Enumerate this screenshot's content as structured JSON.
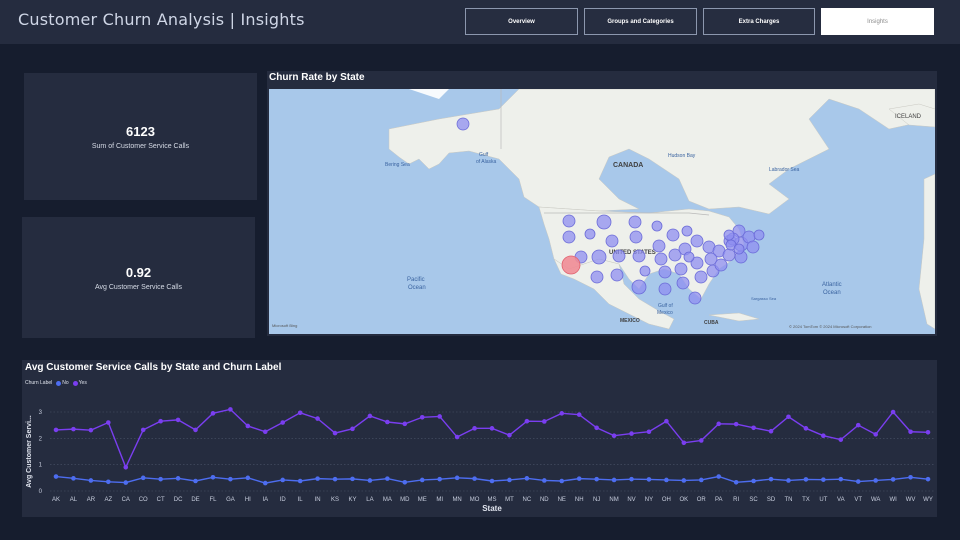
{
  "header": {
    "title": "Customer Churn Analysis | Insights",
    "tabs": [
      {
        "label": "Overview",
        "active": false
      },
      {
        "label": "Groups and Categories",
        "active": false
      },
      {
        "label": "Extra Charges",
        "active": false
      },
      {
        "label": "Insights",
        "active": true
      }
    ]
  },
  "kpis": [
    {
      "value": "6123",
      "label": "Sum of Customer Service Calls"
    },
    {
      "value": "0.92",
      "label": "Avg Customer Service Calls"
    }
  ],
  "map": {
    "title": "Churn Rate by State",
    "labels": {
      "iceland": "ICELAND",
      "bering_sea": "Bering Sea",
      "gulf_of_alaska_1": "Gulf",
      "gulf_of_alaska_2": "of Alaska",
      "canada": "CANADA",
      "hudson_bay": "Hudson Bay",
      "labrador_sea": "Labrador Sea",
      "united_states": "UNITED STATES",
      "pacific_1": "Pacific",
      "pacific_2": "Ocean",
      "atlantic_1": "Atlantic",
      "atlantic_2": "Ocean",
      "sargasso": "Sargasso Sea",
      "gulf_mexico_1": "Gulf of",
      "gulf_mexico_2": "Mexico",
      "mexico": "MEXICO",
      "cuba": "CUBA",
      "microsoft_bing": "Microsoft Bing",
      "copyright": "© 2024 TomTom © 2024 Microsoft Corporation"
    },
    "colors": {
      "bubble": "#8f8ff0",
      "highlight": "#f08c96"
    }
  },
  "chart_data": {
    "type": "line",
    "title": "Avg Customer Service Calls by State and Churn Label",
    "legend_title": "Churn Label",
    "xlabel": "State",
    "ylabel": "Avg Customer Servi...",
    "ylim": [
      0,
      3
    ],
    "yticks": [
      0,
      1,
      2,
      3
    ],
    "grid": true,
    "categories": [
      "AK",
      "AL",
      "AR",
      "AZ",
      "CA",
      "CO",
      "CT",
      "DC",
      "DE",
      "FL",
      "GA",
      "HI",
      "IA",
      "ID",
      "IL",
      "IN",
      "KS",
      "KY",
      "LA",
      "MA",
      "MD",
      "ME",
      "MI",
      "MN",
      "MO",
      "MS",
      "MT",
      "NC",
      "ND",
      "NE",
      "NH",
      "NJ",
      "NM",
      "NV",
      "NY",
      "OH",
      "OK",
      "OR",
      "PA",
      "RI",
      "SC",
      "SD",
      "TN",
      "TX",
      "UT",
      "VA",
      "VT",
      "WA",
      "WI",
      "WV",
      "WY"
    ],
    "series": [
      {
        "name": "No",
        "color": "#4d6df0",
        "values": [
          0.55,
          0.48,
          0.4,
          0.35,
          0.32,
          0.5,
          0.45,
          0.48,
          0.38,
          0.52,
          0.45,
          0.5,
          0.3,
          0.42,
          0.38,
          0.47,
          0.45,
          0.46,
          0.4,
          0.47,
          0.33,
          0.42,
          0.45,
          0.5,
          0.47,
          0.38,
          0.42,
          0.48,
          0.4,
          0.38,
          0.47,
          0.45,
          0.42,
          0.45,
          0.44,
          0.42,
          0.4,
          0.42,
          0.55,
          0.33,
          0.38,
          0.45,
          0.4,
          0.44,
          0.43,
          0.45,
          0.36,
          0.4,
          0.44,
          0.52,
          0.45
        ]
      },
      {
        "name": "Yes",
        "color": "#7a3ef0",
        "values": [
          2.32,
          2.35,
          2.31,
          2.6,
          0.9,
          2.32,
          2.65,
          2.7,
          2.32,
          2.95,
          3.1,
          2.47,
          2.25,
          2.6,
          2.97,
          2.75,
          2.2,
          2.36,
          2.85,
          2.62,
          2.55,
          2.8,
          2.83,
          2.05,
          2.38,
          2.38,
          2.12,
          2.65,
          2.64,
          2.95,
          2.9,
          2.4,
          2.1,
          2.18,
          2.25,
          2.65,
          1.83,
          1.92,
          2.55,
          2.54,
          2.4,
          2.27,
          2.82,
          2.38,
          2.1,
          1.95,
          2.5,
          2.15,
          3.0,
          2.25,
          2.23
        ]
      }
    ]
  }
}
